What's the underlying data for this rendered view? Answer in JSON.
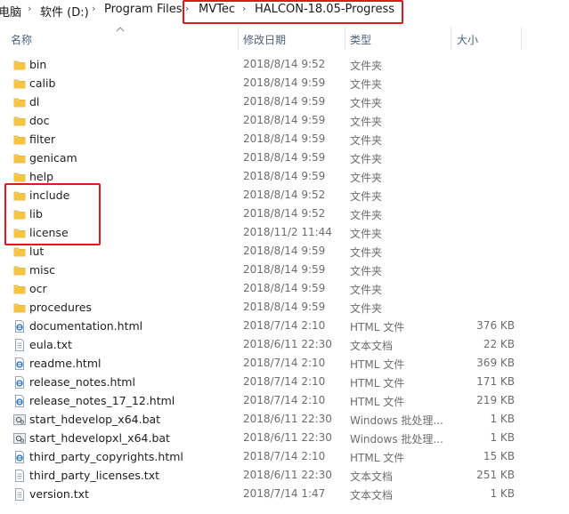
{
  "breadcrumb": {
    "items": [
      "电脑",
      "软件 (D:)",
      "Program Files",
      "MVTec",
      "HALCON-18.05-Progress"
    ],
    "separator": "›"
  },
  "columns": {
    "name": "名称",
    "date": "修改日期",
    "type": "类型",
    "size": "大小"
  },
  "files": [
    {
      "name": "bin",
      "date": "2018/8/14 9:52",
      "type": "文件夹",
      "size": "",
      "icon": "folder-icon"
    },
    {
      "name": "calib",
      "date": "2018/8/14 9:59",
      "type": "文件夹",
      "size": "",
      "icon": "folder-icon"
    },
    {
      "name": "dl",
      "date": "2018/8/14 9:59",
      "type": "文件夹",
      "size": "",
      "icon": "folder-icon"
    },
    {
      "name": "doc",
      "date": "2018/8/14 9:59",
      "type": "文件夹",
      "size": "",
      "icon": "folder-icon"
    },
    {
      "name": "filter",
      "date": "2018/8/14 9:59",
      "type": "文件夹",
      "size": "",
      "icon": "folder-icon"
    },
    {
      "name": "genicam",
      "date": "2018/8/14 9:59",
      "type": "文件夹",
      "size": "",
      "icon": "folder-icon"
    },
    {
      "name": "help",
      "date": "2018/8/14 9:59",
      "type": "文件夹",
      "size": "",
      "icon": "folder-icon"
    },
    {
      "name": "include",
      "date": "2018/8/14 9:52",
      "type": "文件夹",
      "size": "",
      "icon": "folder-icon"
    },
    {
      "name": "lib",
      "date": "2018/8/14 9:52",
      "type": "文件夹",
      "size": "",
      "icon": "folder-icon"
    },
    {
      "name": "license",
      "date": "2018/11/2 11:44",
      "type": "文件夹",
      "size": "",
      "icon": "folder-icon"
    },
    {
      "name": "lut",
      "date": "2018/8/14 9:59",
      "type": "文件夹",
      "size": "",
      "icon": "folder-icon"
    },
    {
      "name": "misc",
      "date": "2018/8/14 9:59",
      "type": "文件夹",
      "size": "",
      "icon": "folder-icon"
    },
    {
      "name": "ocr",
      "date": "2018/8/14 9:59",
      "type": "文件夹",
      "size": "",
      "icon": "folder-icon"
    },
    {
      "name": "procedures",
      "date": "2018/8/14 9:59",
      "type": "文件夹",
      "size": "",
      "icon": "folder-icon"
    },
    {
      "name": "documentation.html",
      "date": "2018/7/14 2:10",
      "type": "HTML 文件",
      "size": "376 KB",
      "icon": "html-file-icon"
    },
    {
      "name": "eula.txt",
      "date": "2018/6/11 22:30",
      "type": "文本文档",
      "size": "22 KB",
      "icon": "text-file-icon"
    },
    {
      "name": "readme.html",
      "date": "2018/7/14 2:10",
      "type": "HTML 文件",
      "size": "369 KB",
      "icon": "html-file-icon"
    },
    {
      "name": "release_notes.html",
      "date": "2018/7/14 2:10",
      "type": "HTML 文件",
      "size": "171 KB",
      "icon": "html-file-icon"
    },
    {
      "name": "release_notes_17_12.html",
      "date": "2018/7/14 2:10",
      "type": "HTML 文件",
      "size": "219 KB",
      "icon": "html-file-icon"
    },
    {
      "name": "start_hdevelop_x64.bat",
      "date": "2018/6/11 22:30",
      "type": "Windows 批处理...",
      "size": "1 KB",
      "icon": "batch-file-icon"
    },
    {
      "name": "start_hdevelopxl_x64.bat",
      "date": "2018/6/11 22:30",
      "type": "Windows 批处理...",
      "size": "1 KB",
      "icon": "batch-file-icon"
    },
    {
      "name": "third_party_copyrights.html",
      "date": "2018/7/14 2:10",
      "type": "HTML 文件",
      "size": "15 KB",
      "icon": "html-file-icon"
    },
    {
      "name": "third_party_licenses.txt",
      "date": "2018/6/11 22:30",
      "type": "文本文档",
      "size": "251 KB",
      "icon": "text-file-icon"
    },
    {
      "name": "version.txt",
      "date": "2018/7/14 1:47",
      "type": "文本文档",
      "size": "1 KB",
      "icon": "text-file-icon"
    }
  ],
  "colors": {
    "highlight": "#e0191b",
    "folder": "#f5c542",
    "html_icon": "#1f6fc5",
    "header_text": "#4c607a"
  }
}
